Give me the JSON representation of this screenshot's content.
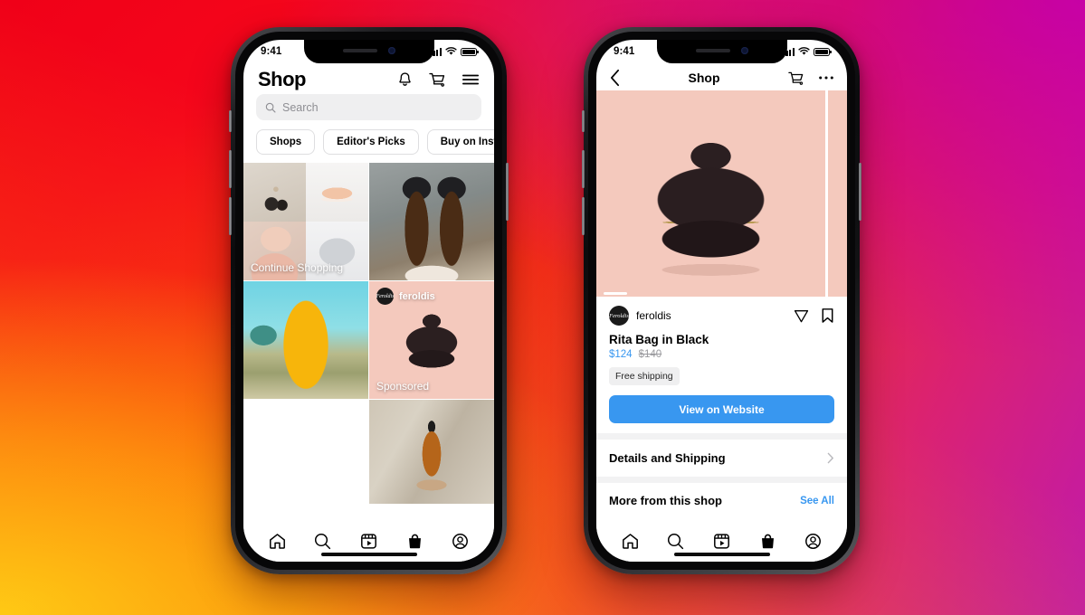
{
  "background": {
    "colors": [
      "#F00018",
      "#B400C8",
      "#FFCD14",
      "#FB7307"
    ]
  },
  "accent": {
    "blue": "#3897F0",
    "grey": "#EFEFF0",
    "hero_pink": "#F4C9BD"
  },
  "phone1": {
    "status": {
      "time": "9:41",
      "signal_icon": "cellular-signal-icon",
      "wifi_icon": "wifi-icon",
      "battery_icon": "battery-icon"
    },
    "header": {
      "title": "Shop",
      "icons": [
        {
          "name": "notifications-bell-icon",
          "label": "Notifications"
        },
        {
          "name": "shopping-cart-icon",
          "label": "Cart"
        },
        {
          "name": "hamburger-menu-icon",
          "label": "Menu"
        }
      ]
    },
    "search": {
      "placeholder": "Search",
      "value": "",
      "icon": "search-icon"
    },
    "pills": [
      {
        "label": "Shops"
      },
      {
        "label": "Editor's Picks"
      },
      {
        "label": "Buy on Instagram"
      }
    ],
    "grid": [
      {
        "name": "continue-shopping-collection",
        "label": "Continue Shopping",
        "kind": "quad"
      },
      {
        "name": "cleaning-sprays-product",
        "label": "",
        "kind": "single"
      },
      {
        "name": "yellow-tracksuit-product",
        "label": "",
        "kind": "single"
      },
      {
        "name": "sponsored-bag-post",
        "label": "Sponsored",
        "kind": "sponsored",
        "shop": "feroldis",
        "avatar_text": "Feroldis"
      },
      {
        "name": "round-sunglasses-product",
        "label": "",
        "kind": "single"
      },
      {
        "name": "amber-dropper-bottle-product",
        "label": "",
        "kind": "single"
      }
    ],
    "tabbar": [
      {
        "name": "tab-home",
        "label": "Home",
        "active": false
      },
      {
        "name": "tab-search",
        "label": "Search",
        "active": false
      },
      {
        "name": "tab-reels",
        "label": "Reels",
        "active": false
      },
      {
        "name": "tab-shop",
        "label": "Shop",
        "active": true
      },
      {
        "name": "tab-profile",
        "label": "Profile",
        "active": false
      }
    ]
  },
  "phone2": {
    "status": {
      "time": "9:41",
      "signal_icon": "cellular-signal-icon",
      "wifi_icon": "wifi-icon",
      "battery_icon": "battery-icon"
    },
    "header": {
      "back_label": "Back",
      "title": "Shop",
      "icons": [
        {
          "name": "shopping-cart-icon",
          "label": "Cart"
        },
        {
          "name": "more-options-icon",
          "label": "More"
        }
      ]
    },
    "hero": {
      "name": "product-image-carousel",
      "alt": "Rita Bag in Black on pink background",
      "slide": "1"
    },
    "product": {
      "shop_name": "feroldis",
      "avatar_text": "Feroldis",
      "share_icon": "share-paper-plane-icon",
      "save_icon": "bookmark-icon",
      "title": "Rita Bag in Black",
      "price": "$124",
      "price_original": "$140",
      "badge": "Free shipping",
      "cta": "View on Website"
    },
    "details_row": {
      "label": "Details and Shipping",
      "chevron": "chevron-right-icon"
    },
    "more_row": {
      "label": "More from this shop",
      "action": "See All"
    },
    "tabbar": [
      {
        "name": "tab-home",
        "label": "Home",
        "active": false
      },
      {
        "name": "tab-search",
        "label": "Search",
        "active": false
      },
      {
        "name": "tab-reels",
        "label": "Reels",
        "active": false
      },
      {
        "name": "tab-shop",
        "label": "Shop",
        "active": true
      },
      {
        "name": "tab-profile",
        "label": "Profile",
        "active": false
      }
    ]
  }
}
